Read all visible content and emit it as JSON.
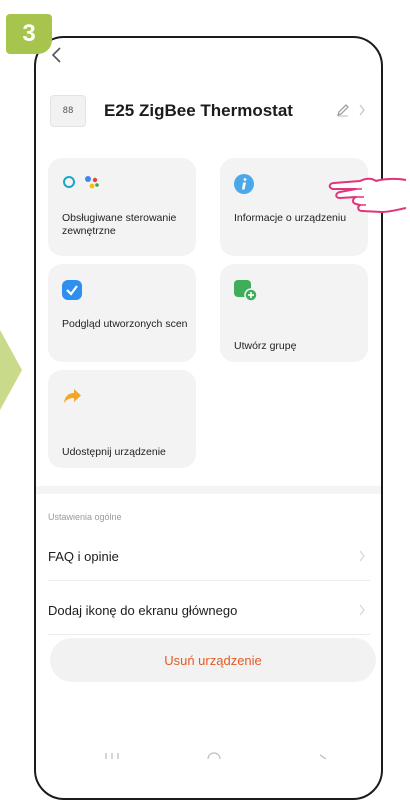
{
  "step": {
    "number": "3"
  },
  "header": {
    "device_name": "E25 ZigBee Thermostat",
    "thumb_text": "88"
  },
  "tiles": [
    {
      "label": "Obsługiwane sterowanie zewnętrzne",
      "icon": "external-control-icons"
    },
    {
      "label": "Informacje o urządzeniu",
      "icon": "info-icon"
    },
    {
      "label": "Podgląd utworzonych scen",
      "icon": "check-badge-icon"
    },
    {
      "label": "Utwórz grupę",
      "icon": "add-group-icon"
    },
    {
      "label": "Udostępnij urządzenie",
      "icon": "share-arrow-icon"
    }
  ],
  "settings": {
    "section_title": "Ustawienia ogólne",
    "items": [
      {
        "label": "FAQ i opinie"
      },
      {
        "label": "Dodaj ikonę do ekranu głównego"
      }
    ]
  },
  "delete_button": {
    "label": "Usuń urządzenie"
  },
  "colors": {
    "accent_green": "#a7c44d",
    "pointer_pink": "#e0357a",
    "delete_orange": "#e35b26",
    "info_blue": "#4aa8e8",
    "check_blue": "#2f8ff0",
    "group_green": "#3fae5a",
    "share_orange": "#f3a622"
  }
}
